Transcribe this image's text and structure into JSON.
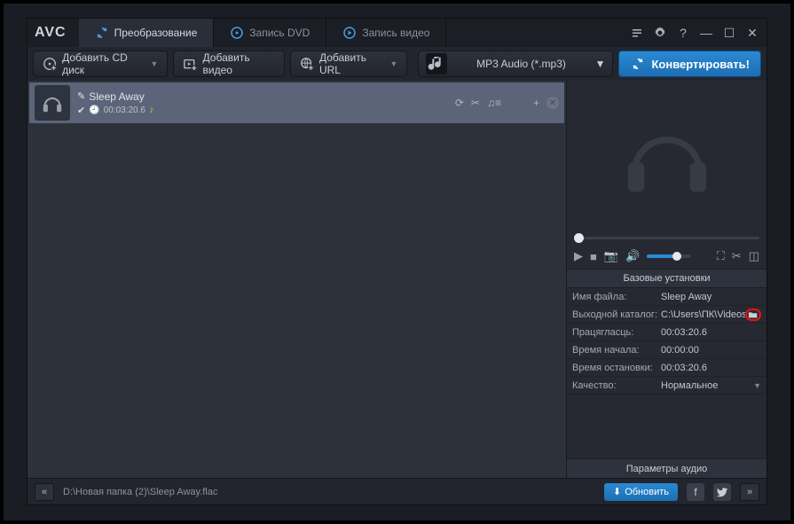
{
  "logo": "AVC",
  "tabs": [
    {
      "label": "Преобразование",
      "active": true
    },
    {
      "label": "Запись DVD",
      "active": false
    },
    {
      "label": "Запись видео",
      "active": false
    }
  ],
  "toolbar": {
    "add_cd": "Добавить CD диск",
    "add_video": "Добавить видео",
    "add_url": "Добавить URL",
    "format_label": "MP3 Audio (*.mp3)",
    "convert": "Конвертировать!"
  },
  "item": {
    "title": "Sleep Away",
    "duration": "00:03:20.6"
  },
  "settings": {
    "header": "Базовые установки",
    "rows": {
      "filename": {
        "k": "Имя файла:",
        "v": "Sleep Away"
      },
      "outdir": {
        "k": "Выходной каталог:",
        "v": "C:\\Users\\ПК\\Videos\\An"
      },
      "duration": {
        "k": "Працягласць:",
        "v": "00:03:20.6"
      },
      "start": {
        "k": "Время начала:",
        "v": "00:00:00"
      },
      "stop": {
        "k": "Время остановки:",
        "v": "00:03:20.6"
      },
      "quality": {
        "k": "Качество:",
        "v": "Нормальное"
      }
    },
    "audio_params": "Параметры аудио"
  },
  "status": {
    "path": "D:\\Новая папка (2)\\Sleep Away.flac",
    "update": "Обновить"
  }
}
